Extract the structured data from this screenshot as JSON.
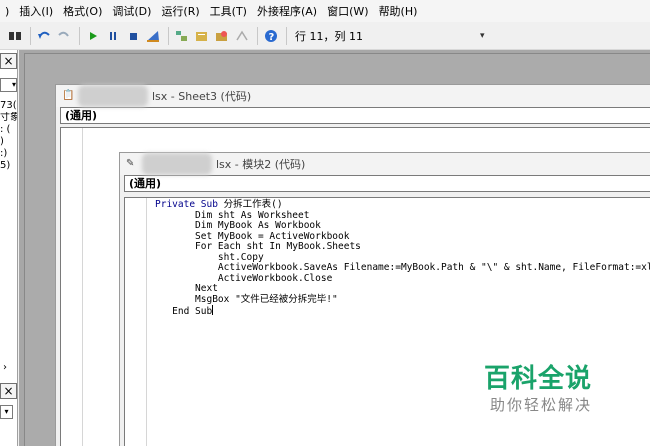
{
  "menu": [
    {
      "label": ")"
    },
    {
      "label": "插入(I)"
    },
    {
      "label": "格式(O)"
    },
    {
      "label": "调试(D)"
    },
    {
      "label": "运行(R)"
    },
    {
      "label": "工具(T)"
    },
    {
      "label": "外接程序(A)"
    },
    {
      "label": "窗口(W)"
    },
    {
      "label": "帮助(H)"
    }
  ],
  "toolbar": {
    "status": "行 11，列 11"
  },
  "left_pane": {
    "close_glyph": "×",
    "lines": [
      "73(",
      "寸象",
      ": (",
      ")",
      ":)",
      "5)"
    ],
    "scroll_glyph": "›"
  },
  "sheet_window": {
    "title": "lsx - Sheet3 (代码)",
    "combo": "(通用)"
  },
  "module_window": {
    "title": "lsx - 模块2 (代码)",
    "combo": "(通用)",
    "code_lines": [
      "Private Sub 分拆工作表()",
      "       Dim sht As Worksheet",
      "       Dim MyBook As Workbook",
      "       Set MyBook = ActiveWorkbook",
      "       For Each sht In MyBook.Sheets",
      "           sht.Copy",
      "           ActiveWorkbook.SaveAs Filename:=MyBook.Path & \"\\\" & sht.Name, FileFormat:=xlNo",
      "           ActiveWorkbook.Close",
      "       Next",
      "       MsgBox \"文件已经被分拆完毕!\"",
      "   End Sub"
    ]
  },
  "watermark": {
    "main": "百科全说",
    "sub": "助你轻松解决"
  }
}
